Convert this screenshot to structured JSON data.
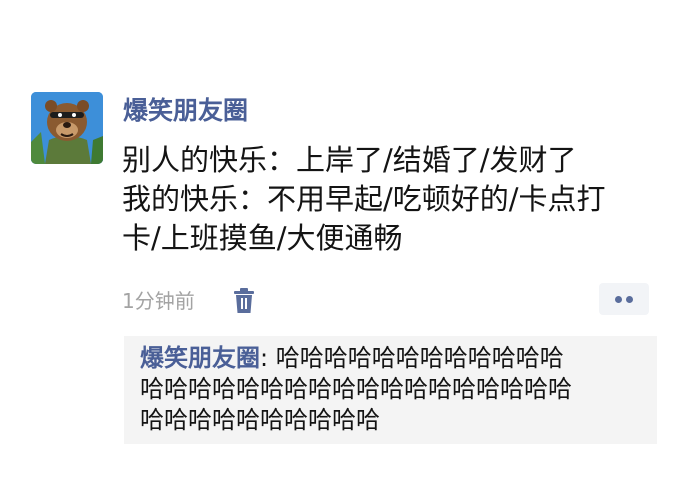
{
  "post": {
    "author": "爆笑朋友圈",
    "avatar_icon": "bear-avatar",
    "lines": [
      "别人的快乐：上岸了/结婚了/发财了",
      "我的快乐：不用早起/吃顿好的/卡点打",
      "卡/上班摸鱼/大便通畅"
    ],
    "time": "1分钟前",
    "delete_icon": "trash-icon",
    "more_icon": "more-dots-icon"
  },
  "comment": {
    "author": "爆笑朋友圈",
    "separator": ": ",
    "lines": [
      "哈哈哈哈哈哈哈哈哈哈哈哈",
      "哈哈哈哈哈哈哈哈哈哈哈哈哈哈哈哈哈哈",
      "哈哈哈哈哈哈哈哈哈哈"
    ]
  },
  "colors": {
    "link_blue": "#4a5f97",
    "text": "#141414",
    "muted": "#a3a3a3",
    "comment_bg": "#f4f4f4"
  }
}
